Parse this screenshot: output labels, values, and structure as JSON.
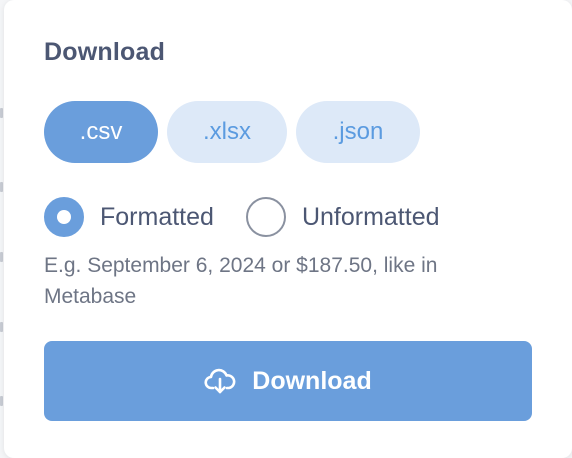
{
  "panel": {
    "title": "Download",
    "formats": [
      {
        "label": ".csv",
        "selected": true
      },
      {
        "label": ".xlsx",
        "selected": false
      },
      {
        "label": ".json",
        "selected": false
      }
    ],
    "formatting": {
      "options": [
        {
          "label": "Formatted",
          "checked": true
        },
        {
          "label": "Unformatted",
          "checked": false
        }
      ],
      "hint": "E.g. September 6, 2024 or $187.50, like in Metabase"
    },
    "download_button": {
      "label": "Download",
      "icon": "cloud-download-icon"
    }
  },
  "colors": {
    "accent": "#6a9edc",
    "accent_light": "#dde9f8",
    "text_dark": "#4c5773",
    "text_muted": "#6e7585"
  }
}
